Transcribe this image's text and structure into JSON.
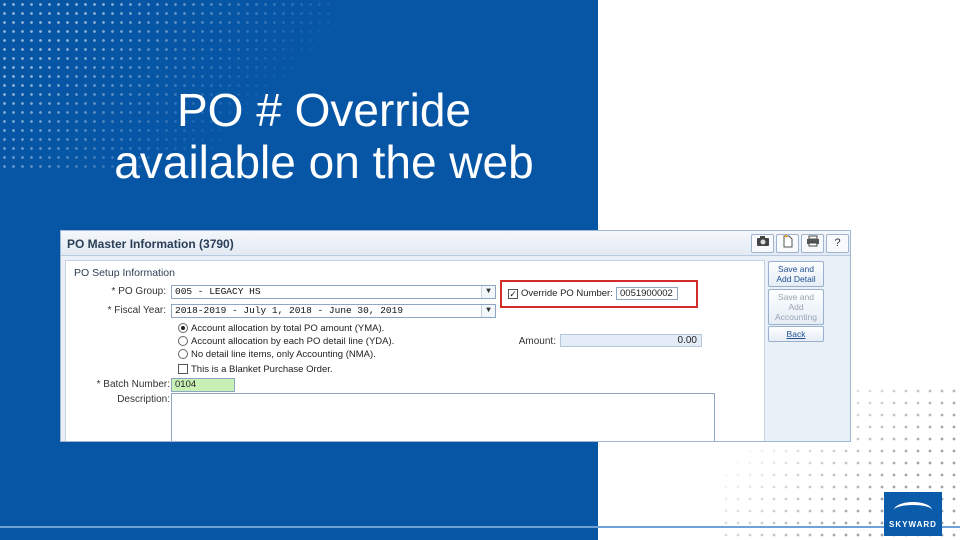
{
  "slide": {
    "title_line1": "PO # Override",
    "title_line2": "available on the web",
    "logo_text": "SKYWARD",
    "colors": {
      "panel_blue": "#0756a6",
      "highlight_red": "#d32c2c",
      "batch_green": "#c9f0b4"
    }
  },
  "screen": {
    "title": "PO Master Information (3790)",
    "toolbar_icons": [
      "camera-icon",
      "document-icon",
      "print-icon",
      "help-icon"
    ],
    "help_glyph": "?",
    "section": "PO Setup Information",
    "fields": {
      "po_group_label": "* PO Group:",
      "po_group_value": "005 - LEGACY HS",
      "fiscal_year_label": "* Fiscal Year:",
      "fiscal_year_value": "2018-2019 - July 1, 2018 - June 30, 2019",
      "batch_label": "* Batch Number:",
      "batch_value": "0104",
      "description_label": "Description:",
      "description_value": ""
    },
    "allocation_options": [
      {
        "label": "Account allocation by total PO amount (YMA).",
        "selected": true
      },
      {
        "label": "Account allocation by each PO detail line (YDA).",
        "selected": false
      },
      {
        "label": "No detail line items, only Accounting (NMA).",
        "selected": false
      }
    ],
    "blanket_po_label": "This is a Blanket Purchase Order.",
    "blanket_po_checked": false,
    "override": {
      "label": "Override PO Number:",
      "checked": true,
      "value": "0051900002"
    },
    "amount": {
      "label": "Amount:",
      "value": "0.00"
    },
    "buttons": {
      "save_add_detail": "Save and Add Detail",
      "save_add_accounting": "Save and Add Accounting",
      "back": "Back"
    }
  }
}
